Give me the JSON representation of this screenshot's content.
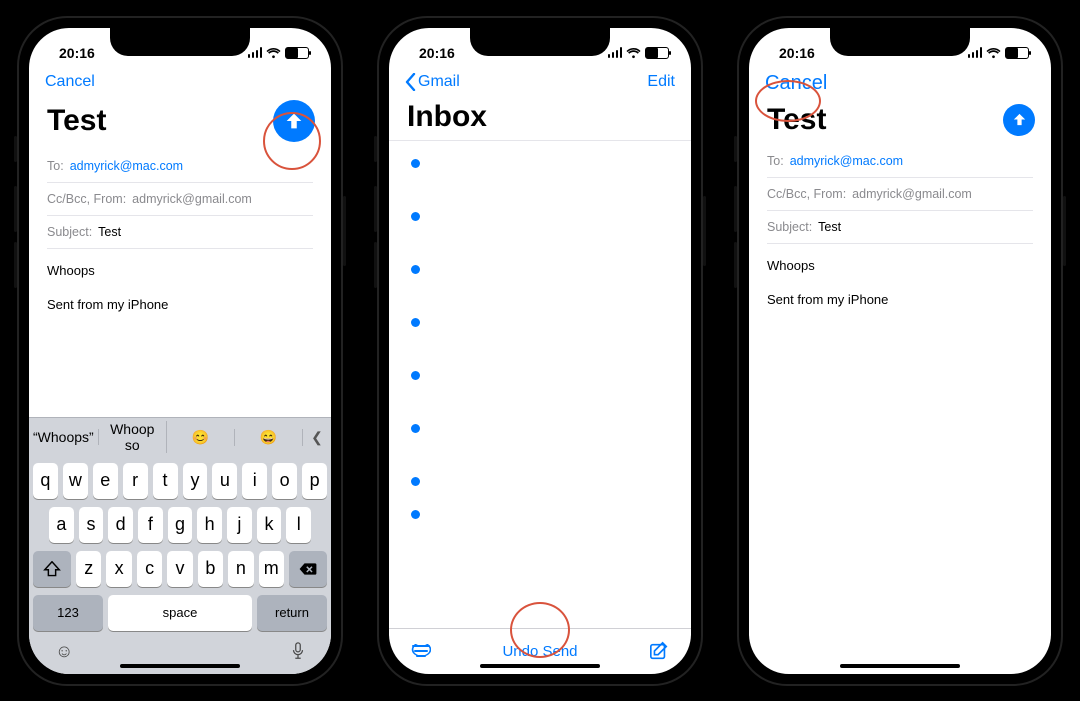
{
  "status": {
    "time": "20:16"
  },
  "compose": {
    "cancel": "Cancel",
    "title": "Test",
    "to_label": "To:",
    "to_value": "admyrick@mac.com",
    "ccbcc_label": "Cc/Bcc, From:",
    "ccbcc_value": "admyrick@gmail.com",
    "subject_label": "Subject:",
    "subject_value": "Test",
    "body_line1": "Whoops",
    "body_line2": "Sent from my iPhone"
  },
  "inbox": {
    "back": "Gmail",
    "edit": "Edit",
    "title": "Inbox",
    "undo": "Undo Send"
  },
  "keyboard": {
    "sugg1": "“Whoops”",
    "sugg2": "Whoop so",
    "row1": [
      "q",
      "w",
      "e",
      "r",
      "t",
      "y",
      "u",
      "i",
      "o",
      "p"
    ],
    "row2": [
      "a",
      "s",
      "d",
      "f",
      "g",
      "h",
      "j",
      "k",
      "l"
    ],
    "row3": [
      "z",
      "x",
      "c",
      "v",
      "b",
      "n",
      "m"
    ],
    "num": "123",
    "space": "space",
    "return": "return"
  }
}
